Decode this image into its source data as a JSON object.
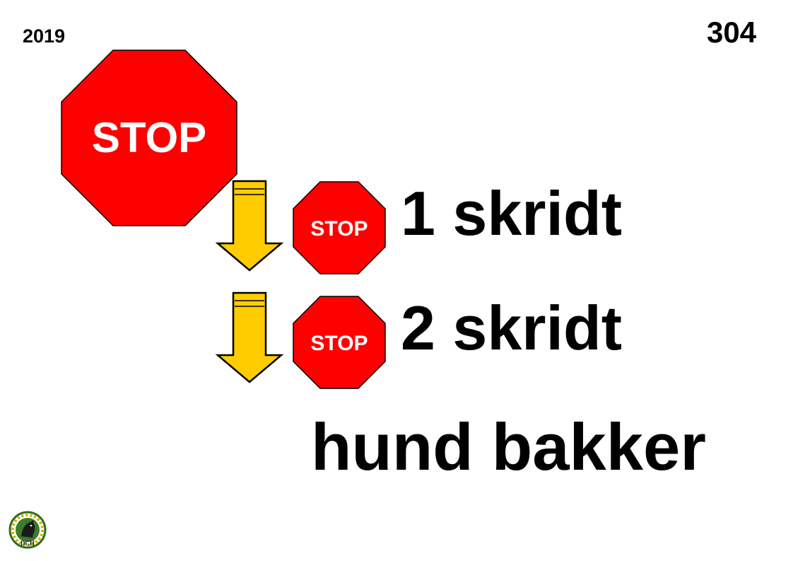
{
  "header": {
    "year": "2019",
    "sign_number": "304"
  },
  "signs": {
    "main_stop": "STOP",
    "small_stop_1": "STOP",
    "small_stop_2": "STOP"
  },
  "steps": {
    "step1": "1 skridt",
    "step2": "2 skridt",
    "action": "hund bakker"
  },
  "logo": {
    "text": "DCH"
  },
  "colors": {
    "stop_red": "#ff0000",
    "arrow_yellow": "#ffcc00",
    "outline": "#000000"
  }
}
